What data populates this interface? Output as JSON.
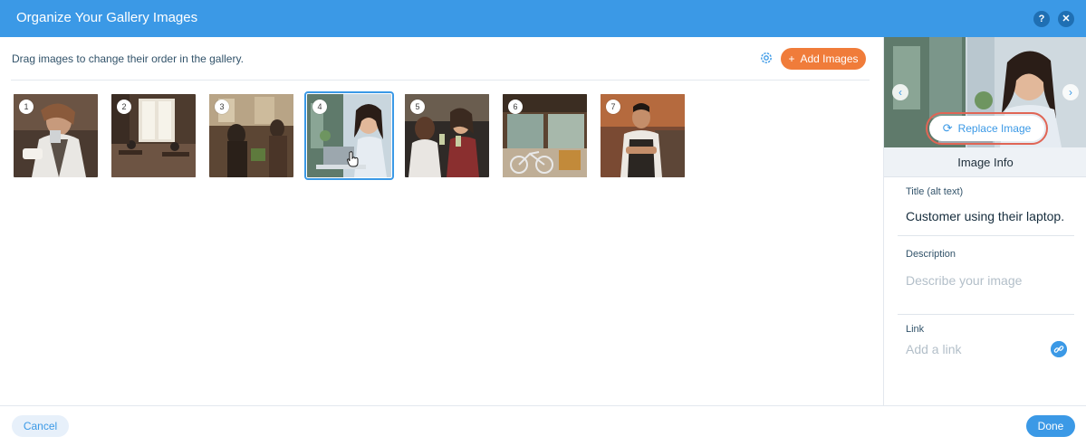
{
  "dialog": {
    "title": "Organize Your Gallery Images",
    "help_glyph": "?",
    "close_glyph": "✕"
  },
  "toolbar": {
    "instructions": "Drag images to change their order in the gallery.",
    "add_images_label": "Add Images",
    "add_images_glyph": "+"
  },
  "gallery": {
    "selected_index": 4,
    "images": [
      {
        "number": "1",
        "icon": "barista-pouring-milk-photo"
      },
      {
        "number": "2",
        "icon": "cafe-interior-photo"
      },
      {
        "number": "3",
        "icon": "street-cafe-photo"
      },
      {
        "number": "4",
        "icon": "customer-laptop-photo"
      },
      {
        "number": "5",
        "icon": "friends-toasting-photo"
      },
      {
        "number": "6",
        "icon": "cafe-storefront-bicycle-photo"
      },
      {
        "number": "7",
        "icon": "barista-arms-crossed-photo"
      }
    ]
  },
  "panel": {
    "prev_glyph": "‹",
    "next_glyph": "›",
    "replace_label": "Replace Image",
    "replace_glyph": "⟳",
    "info_header": "Image Info",
    "title_label": "Title (alt text)",
    "title_value": "Customer using their laptop.",
    "description_label": "Description",
    "description_placeholder": "Describe your image",
    "link_label": "Link",
    "link_placeholder": "Add a link"
  },
  "footer": {
    "cancel_label": "Cancel",
    "done_label": "Done"
  },
  "colors": {
    "header": "#3b99e6",
    "accent": "#3b99e6",
    "add_button": "#f07c3a",
    "highlight": "#e06555"
  }
}
